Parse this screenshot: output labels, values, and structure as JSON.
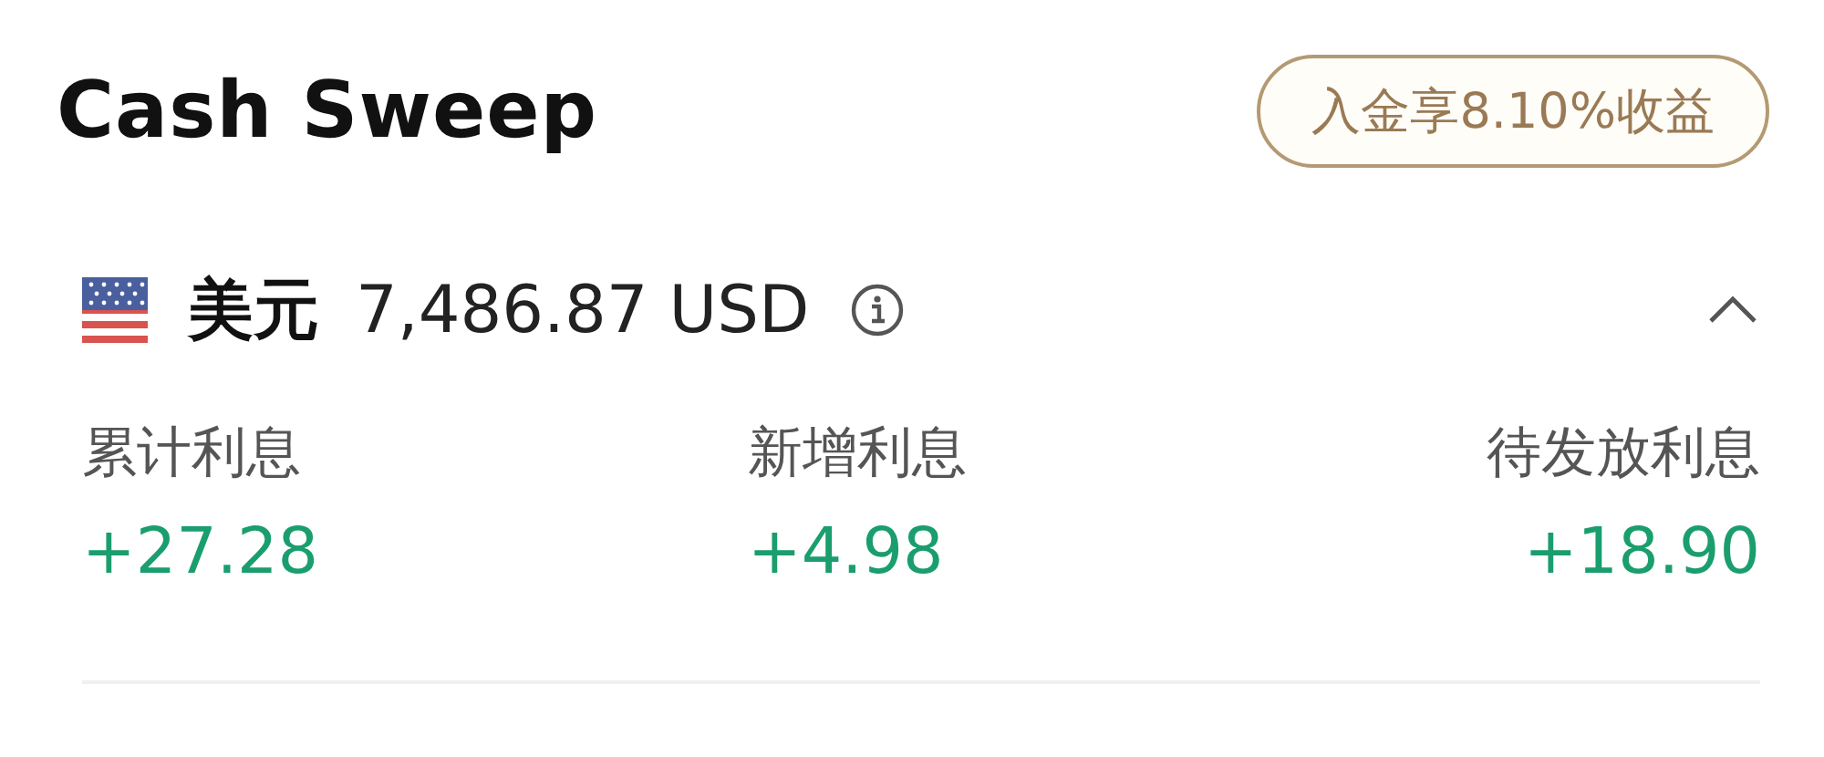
{
  "title": "Cash Sweep",
  "promo_badge": "入金享8.10%收益",
  "currency": {
    "name": "美元",
    "amount": "7,486.87 USD",
    "expanded": true
  },
  "stats": [
    {
      "label": "累计利息",
      "value": "+27.28"
    },
    {
      "label": "新增利息",
      "value": "+4.98"
    },
    {
      "label": "待发放利息",
      "value": "+18.90"
    }
  ]
}
